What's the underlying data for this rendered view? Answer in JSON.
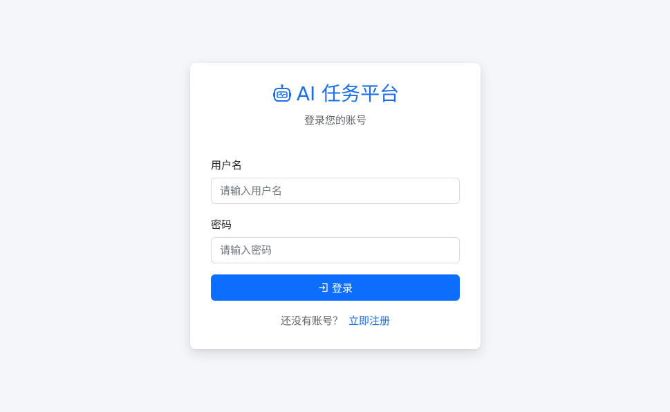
{
  "brand": {
    "icon": "robot-icon",
    "title": "AI 任务平台",
    "color": "#1a6fe8"
  },
  "subtitle": "登录您的账号",
  "form": {
    "username": {
      "label": "用户名",
      "placeholder": "请输入用户名",
      "value": ""
    },
    "password": {
      "label": "密码",
      "placeholder": "请输入密码",
      "value": ""
    },
    "submit": {
      "icon": "login-icon",
      "label": "登录",
      "color": "#0d6efd"
    }
  },
  "footer": {
    "prompt": "还没有账号？",
    "link_label": "立即注册"
  }
}
